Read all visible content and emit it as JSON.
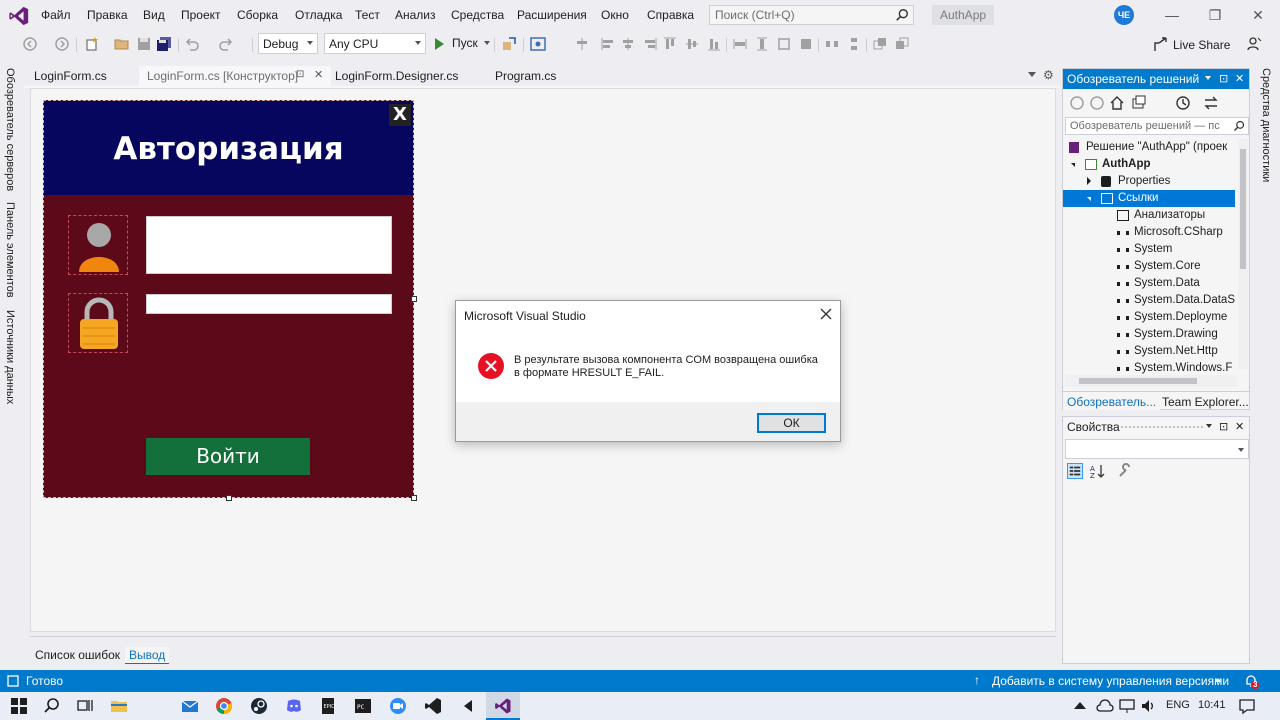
{
  "menu": {
    "items": [
      "Файл",
      "Правка",
      "Вид",
      "Проект",
      "Сборка",
      "Отладка",
      "Тест",
      "Анализ",
      "Средства",
      "Расширения",
      "Окно",
      "Справка"
    ],
    "search_placeholder": "Поиск (Ctrl+Q)",
    "project_name": "AuthApp",
    "user_initials": "ЧЕ"
  },
  "toolbar": {
    "config": "Debug",
    "platform": "Any CPU",
    "start_label": "Пуск",
    "live_share": "Live Share"
  },
  "left_tabs": [
    "Обозреватель серверов",
    "Панель элементов",
    "Источники данных"
  ],
  "right_tabs": [
    "Средства диагностики"
  ],
  "doc_tabs": [
    {
      "label": "LoginForm.cs"
    },
    {
      "label": "LoginForm.cs [Конструктор]"
    },
    {
      "label": "LoginForm.Designer.cs"
    },
    {
      "label": "Program.cs"
    }
  ],
  "login_form": {
    "title": "Авторизация",
    "close": "X",
    "button": "Войти"
  },
  "dialog": {
    "title": "Microsoft Visual Studio",
    "message": "В результате вызова компонента COM возвращена ошибка в формате HRESULT E_FAIL.",
    "ok": "ОК"
  },
  "solution_explorer": {
    "title": "Обозреватель решений",
    "search_placeholder": "Обозреватель решений — пс",
    "tree": [
      {
        "label": "Решение \"AuthApp\" (проек",
        "indent": 0,
        "icon": "solution-icon"
      },
      {
        "label": "AuthApp",
        "indent": 1,
        "icon": "csharp-project-icon",
        "bold": true
      },
      {
        "label": "Properties",
        "indent": 2,
        "icon": "wrench-icon"
      },
      {
        "label": "Ссылки",
        "indent": 2,
        "icon": "references-icon",
        "selected": true
      },
      {
        "label": "Анализаторы",
        "indent": 3,
        "icon": "analyzer-icon"
      },
      {
        "label": "Microsoft.CSharp",
        "indent": 3,
        "icon": "reference-icon"
      },
      {
        "label": "System",
        "indent": 3,
        "icon": "reference-icon"
      },
      {
        "label": "System.Core",
        "indent": 3,
        "icon": "reference-icon"
      },
      {
        "label": "System.Data",
        "indent": 3,
        "icon": "reference-icon"
      },
      {
        "label": "System.Data.DataS",
        "indent": 3,
        "icon": "reference-icon"
      },
      {
        "label": "System.Deployme",
        "indent": 3,
        "icon": "reference-icon"
      },
      {
        "label": "System.Drawing",
        "indent": 3,
        "icon": "reference-icon"
      },
      {
        "label": "System.Net.Http",
        "indent": 3,
        "icon": "reference-icon"
      },
      {
        "label": "System.Windows.F",
        "indent": 3,
        "icon": "reference-icon"
      }
    ],
    "tabs": [
      "Обозреватель...",
      "Team Explorer..."
    ]
  },
  "properties": {
    "title": "Свойства"
  },
  "output_tabs": [
    "Список ошибок",
    "Вывод"
  ],
  "statusbar": {
    "status": "Готово",
    "vcs": "Добавить в систему управления версиями"
  },
  "taskbar": {
    "lang": "ENG",
    "time": "10:41",
    "notif_count": "3"
  },
  "colors": {
    "accent": "#007acc",
    "form_header": "#06065e",
    "form_body": "#5c0a1a",
    "login_button": "#14703a",
    "error_red": "#e81123"
  }
}
